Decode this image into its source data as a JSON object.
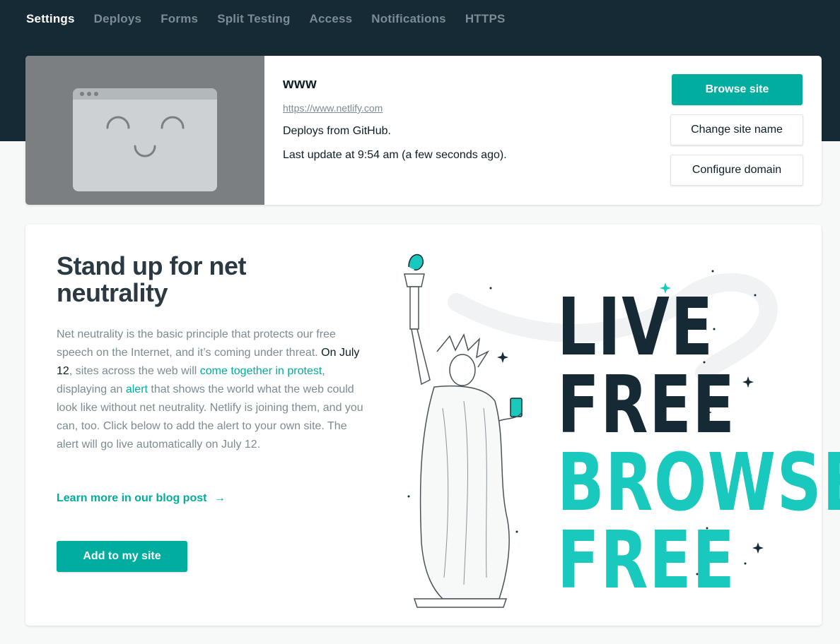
{
  "tabs": [
    "Settings",
    "Deploys",
    "Forms",
    "Split Testing",
    "Access",
    "Notifications",
    "HTTPS"
  ],
  "site": {
    "name": "www",
    "url": "https://www.netlify.com",
    "deploys_from": "Deploys from GitHub.",
    "last_update": "Last update at 9:54 am (a few seconds ago)."
  },
  "actions": {
    "browse": "Browse site",
    "change_name": "Change site name",
    "configure_domain": "Configure domain"
  },
  "promo": {
    "title": "Stand up for net neutrality",
    "body_1": "Net neutrality is the basic principle that protects our free speech on the Internet, and it’s coming under threat. ",
    "body_date": "On July 12",
    "body_2": ", sites across the web will ",
    "body_link_1": "come together in protest",
    "body_3": ", displaying an ",
    "body_link_2": "alert",
    "body_4": " that shows the world what the web could look like without net neutrality. Netlify is joining them, and you can, too. Click below to add the alert to your own site. The alert will go live automatically on July 12.",
    "learn_more": "Learn more in our blog post",
    "learn_more_arrow": "→",
    "add_button": "Add to my site"
  },
  "poster": {
    "line1": "LIVE",
    "line2": "FREE",
    "line3": "BROWSE",
    "line4": "FREE"
  },
  "colors": {
    "accent": "#00ad9f",
    "header_bg": "#152a35",
    "poster_dark": "#152a35",
    "poster_teal": "#1ac9bd"
  }
}
